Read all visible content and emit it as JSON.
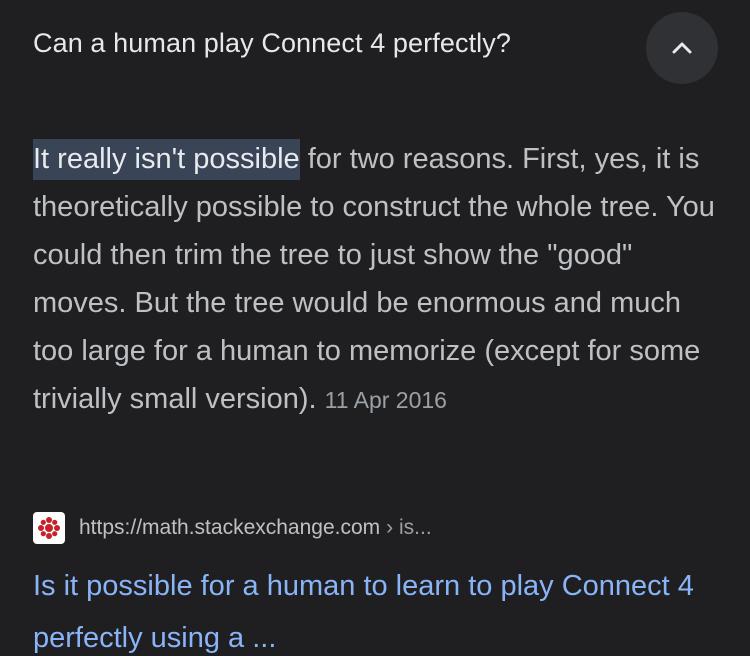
{
  "question": "Can a human play Connect 4 perfectly?",
  "snippet": {
    "highlight": "It really isn't possible",
    "text": " for two reasons. First, yes, it is theoretically possible to construct the whole tree. You could then trim the tree to just show the \"good\" moves. But the tree would be enormous and much too large for a human to memorize (except for some trivially small version).",
    "date": "11 Apr 2016"
  },
  "source": {
    "url": "https://math.stackexchange.com",
    "path": "› is..."
  },
  "result_title": "Is it possible for a human to learn to play Connect 4 perfectly using a ...",
  "icons": {
    "collapse": "chevron-up-icon",
    "favicon": "stackexchange-favicon-icon"
  },
  "colors": {
    "background": "#1f1f21",
    "highlight": "#394457",
    "link": "#8ab4f8",
    "favicon_red": "#c8202a"
  }
}
